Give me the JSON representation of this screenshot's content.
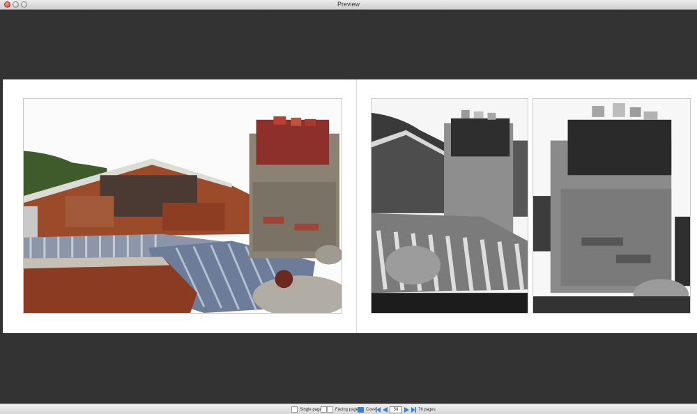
{
  "window": {
    "title": "Preview"
  },
  "toolbar": {
    "single_page_label": "Single page",
    "facing_pages_label": "Facing pages",
    "cover_label": "Cover",
    "current_page": "58",
    "total_pages_label": "76 pages"
  },
  "icons": [
    "close-icon",
    "minimize-icon",
    "zoom-icon",
    "first-page-icon",
    "previous-page-icon",
    "next-page-icon",
    "last-page-icon",
    "book-cover-icon"
  ],
  "colors": {
    "accent": "#3b7fd4",
    "viewer_background": "#333333",
    "page_background": "#ffffff"
  }
}
